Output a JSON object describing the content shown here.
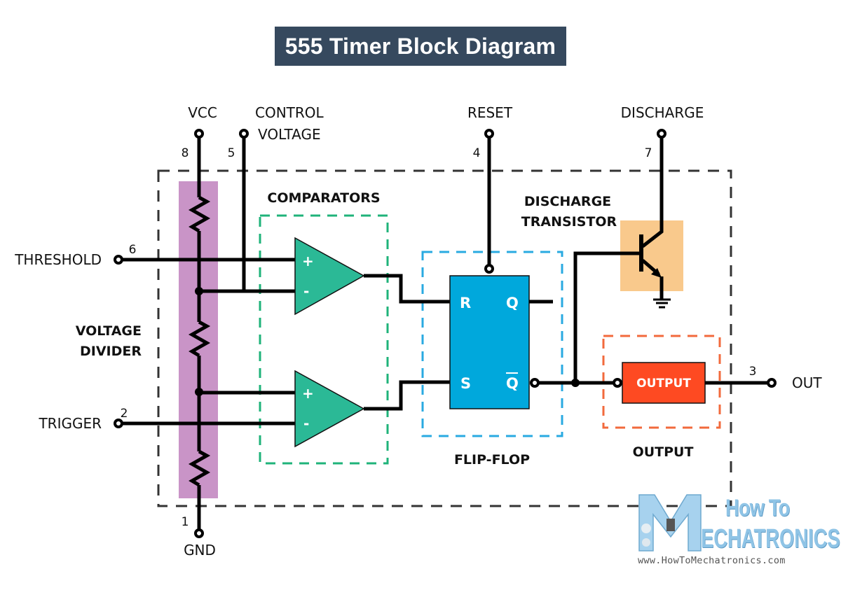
{
  "title": "555 Timer Block Diagram",
  "colors": {
    "title_bg": "#36495e",
    "voltage_divider": "#c994c7",
    "comparator": "#2bb996",
    "comparator_border": "#1fb37a",
    "flip_flop": "#00a8dc",
    "flip_flop_border": "#29aae1",
    "transistor_bg": "#f9c98c",
    "output_block": "#fe4a22",
    "output_border": "#f26a3c",
    "chip_border": "#333333"
  },
  "pins": [
    {
      "number": "8",
      "label": "VCC"
    },
    {
      "number": "5",
      "label_line1": "CONTROL",
      "label_line2": "VOLTAGE"
    },
    {
      "number": "4",
      "label": "RESET"
    },
    {
      "number": "7",
      "label": "DISCHARGE"
    },
    {
      "number": "6",
      "label": "THRESHOLD"
    },
    {
      "number": "2",
      "label": "TRIGGER"
    },
    {
      "number": "1",
      "label": "GND"
    },
    {
      "number": "3",
      "label": "OUT"
    }
  ],
  "blocks": {
    "comparators": "COMPARATORS",
    "voltage_divider_line1": "VOLTAGE",
    "voltage_divider_line2": "DIVIDER",
    "flip_flop": "FLIP-FLOP",
    "discharge_transistor_line1": "DISCHARGE",
    "discharge_transistor_line2": "TRANSISTOR",
    "output": "OUTPUT",
    "output_inner": "OUTPUT"
  },
  "comparator_signs": {
    "plus": "+",
    "minus": "-"
  },
  "flip_flop_ports": {
    "r": "R",
    "q": "Q",
    "s": "S",
    "q_bar": "Q"
  },
  "logo": {
    "line1": "How To",
    "line2": "ECHATRONICS",
    "url": "www.HowToMechatronics.com"
  }
}
